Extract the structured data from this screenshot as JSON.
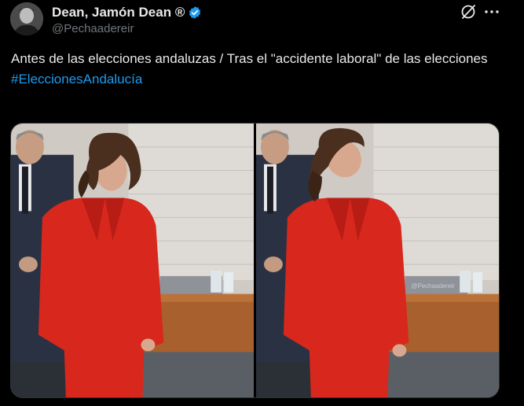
{
  "tweet": {
    "author": {
      "display_name": "Dean, Jamón Dean ®",
      "handle": "@Pechaadereir",
      "verified": true,
      "avatar_icon": "avatar-photo"
    },
    "actions": {
      "grok_icon": "grok-icon",
      "more_icon": "more-options-icon",
      "more_label": "···"
    },
    "text_line": "Antes de las elecciones andaluzas / Tras el \"accidente laboral\" de las elecciones",
    "hashtag": "#EleccionesAndalucía",
    "media": {
      "count": 2,
      "watermark": "@Pechaadereir"
    },
    "colors": {
      "background": "#000000",
      "text": "#e7e9ea",
      "secondary": "#71767b",
      "link": "#1d9bf0",
      "verified": "#1d9bf0",
      "jacket": "#d8271d"
    }
  }
}
